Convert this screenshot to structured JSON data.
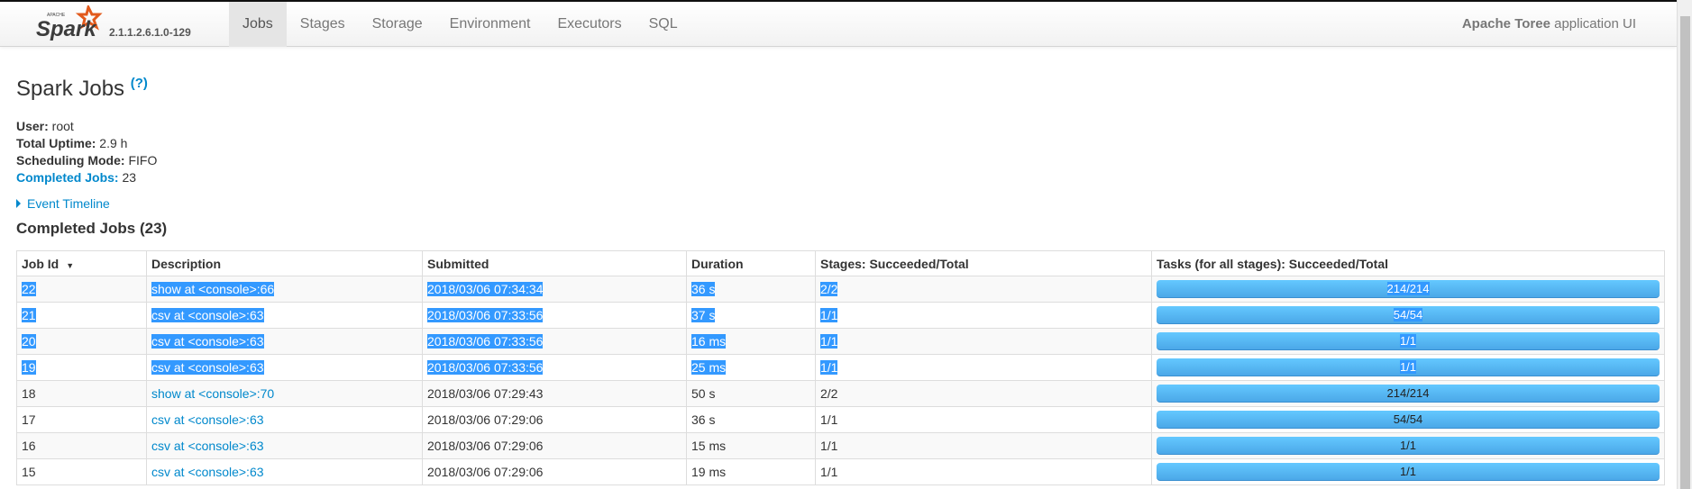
{
  "nav": {
    "logo_text": "Apache Spark",
    "version": "2.1.1.2.6.1.0-129",
    "tabs": [
      {
        "label": "Jobs",
        "active": true
      },
      {
        "label": "Stages"
      },
      {
        "label": "Storage"
      },
      {
        "label": "Environment"
      },
      {
        "label": "Executors"
      },
      {
        "label": "SQL"
      }
    ],
    "app_name_bold": "Apache Toree",
    "app_name_rest": " application UI"
  },
  "page": {
    "title": "Spark Jobs",
    "help": "(?)",
    "user_label": "User:",
    "user": " root",
    "uptime_label": "Total Uptime:",
    "uptime": " 2.9 h",
    "mode_label": "Scheduling Mode:",
    "mode": " FIFO",
    "completed_label": "Completed Jobs:",
    "completed": " 23",
    "timeline": "Event Timeline",
    "section_title": "Completed Jobs (23)"
  },
  "table": {
    "headers": [
      "Job Id",
      "Description",
      "Submitted",
      "Duration",
      "Stages: Succeeded/Total",
      "Tasks (for all stages): Succeeded/Total"
    ],
    "rows": [
      {
        "id": "22",
        "desc": "show at <console>:66",
        "submitted": "2018/03/06 07:34:34",
        "duration": "36 s",
        "stages": "2/2",
        "tasks": "214/214",
        "selected": true
      },
      {
        "id": "21",
        "desc": "csv at <console>:63",
        "submitted": "2018/03/06 07:33:56",
        "duration": "37 s",
        "stages": "1/1",
        "tasks": "54/54",
        "selected": true
      },
      {
        "id": "20",
        "desc": "csv at <console>:63",
        "submitted": "2018/03/06 07:33:56",
        "duration": "16 ms",
        "stages": "1/1",
        "tasks": "1/1",
        "selected": true
      },
      {
        "id": "19",
        "desc": "csv at <console>:63",
        "submitted": "2018/03/06 07:33:56",
        "duration": "25 ms",
        "stages": "1/1",
        "tasks": "1/1",
        "selected": true
      },
      {
        "id": "18",
        "desc": "show at <console>:70",
        "submitted": "2018/03/06 07:29:43",
        "duration": "50 s",
        "stages": "2/2",
        "tasks": "214/214"
      },
      {
        "id": "17",
        "desc": "csv at <console>:63",
        "submitted": "2018/03/06 07:29:06",
        "duration": "36 s",
        "stages": "1/1",
        "tasks": "54/54"
      },
      {
        "id": "16",
        "desc": "csv at <console>:63",
        "submitted": "2018/03/06 07:29:06",
        "duration": "15 ms",
        "stages": "1/1",
        "tasks": "1/1"
      },
      {
        "id": "15",
        "desc": "csv at <console>:63",
        "submitted": "2018/03/06 07:29:06",
        "duration": "19 ms",
        "stages": "1/1",
        "tasks": "1/1"
      }
    ]
  },
  "colors": {
    "link": "#0088cc",
    "progress": "#5bb8f5",
    "selection": "#3399ff",
    "logo_star": "#e25a1c"
  }
}
